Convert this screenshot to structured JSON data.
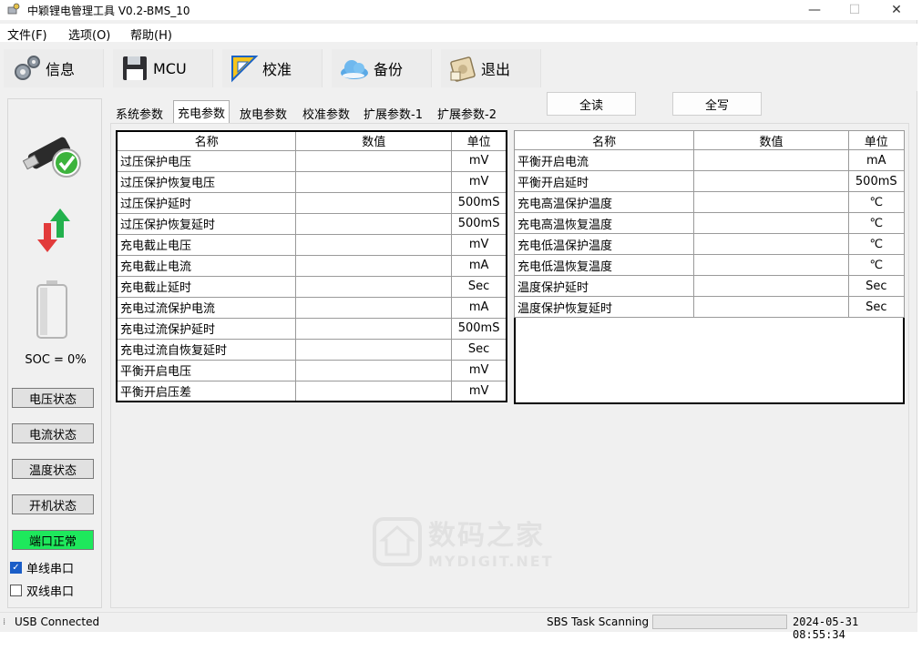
{
  "window": {
    "title": "中颖锂电管理工具 V0.2-BMS_10",
    "minimize_glyph": "—",
    "maximize_glyph": "☐",
    "close_glyph": "✕"
  },
  "menu": [
    "文件(F)",
    "选项(O)",
    "帮助(H)"
  ],
  "toolbar": [
    {
      "label": "信息",
      "icon": "gears-icon"
    },
    {
      "label": "MCU",
      "icon": "floppy-disk-icon"
    },
    {
      "label": "校准",
      "icon": "ruler-icon"
    },
    {
      "label": "备份",
      "icon": "cloud-icon"
    },
    {
      "label": "退出",
      "icon": "exit-disk-icon"
    }
  ],
  "left_panel": {
    "soc_text": "SOC = 0%",
    "buttons": [
      "电压状态",
      "电流状态",
      "温度状态",
      "开机状态"
    ],
    "port_status": "端口正常",
    "port_status_color": "#1ee85c",
    "checkboxes": [
      {
        "label": "单线串口",
        "checked": true
      },
      {
        "label": "双线串口",
        "checked": false
      }
    ]
  },
  "tabs": [
    {
      "label": "系统参数",
      "active": false
    },
    {
      "label": "充电参数",
      "active": true
    },
    {
      "label": "放电参数",
      "active": false
    },
    {
      "label": "校准参数",
      "active": false
    },
    {
      "label": "扩展参数-1",
      "active": false
    },
    {
      "label": "扩展参数-2",
      "active": false
    }
  ],
  "actions": {
    "read_all": "全读",
    "write_all": "全写"
  },
  "table_headers": {
    "name": "名称",
    "value": "数值",
    "unit": "单位"
  },
  "left_table": [
    {
      "name": "过压保护电压",
      "value": "",
      "unit": "mV"
    },
    {
      "name": "过压保护恢复电压",
      "value": "",
      "unit": "mV"
    },
    {
      "name": "过压保护延时",
      "value": "",
      "unit": "500mS"
    },
    {
      "name": "过压保护恢复延时",
      "value": "",
      "unit": "500mS"
    },
    {
      "name": "充电截止电压",
      "value": "",
      "unit": "mV"
    },
    {
      "name": "充电截止电流",
      "value": "",
      "unit": "mA"
    },
    {
      "name": "充电截止延时",
      "value": "",
      "unit": "Sec"
    },
    {
      "name": "充电过流保护电流",
      "value": "",
      "unit": "mA"
    },
    {
      "name": "充电过流保护延时",
      "value": "",
      "unit": "500mS"
    },
    {
      "name": "充电过流自恢复延时",
      "value": "",
      "unit": "Sec"
    },
    {
      "name": "平衡开启电压",
      "value": "",
      "unit": "mV"
    },
    {
      "name": "平衡开启压差",
      "value": "",
      "unit": "mV"
    }
  ],
  "right_table": [
    {
      "name": "平衡开启电流",
      "value": "",
      "unit": "mA"
    },
    {
      "name": "平衡开启延时",
      "value": "",
      "unit": "500mS"
    },
    {
      "name": "充电高温保护温度",
      "value": "",
      "unit": "℃"
    },
    {
      "name": "充电高温恢复温度",
      "value": "",
      "unit": "℃"
    },
    {
      "name": "充电低温保护温度",
      "value": "",
      "unit": "℃"
    },
    {
      "name": "充电低温恢复温度",
      "value": "",
      "unit": "℃"
    },
    {
      "name": "温度保护延时",
      "value": "",
      "unit": "Sec"
    },
    {
      "name": "温度保护恢复延时",
      "value": "",
      "unit": "Sec"
    }
  ],
  "status_bar": {
    "connection": "USB Connected",
    "task": "SBS Task Scanning",
    "progress": 0,
    "datetime": "2024-05-31 08:55:34"
  },
  "watermark": {
    "text_zh": "数码之家",
    "text_en": "MYDIGIT.NET"
  }
}
